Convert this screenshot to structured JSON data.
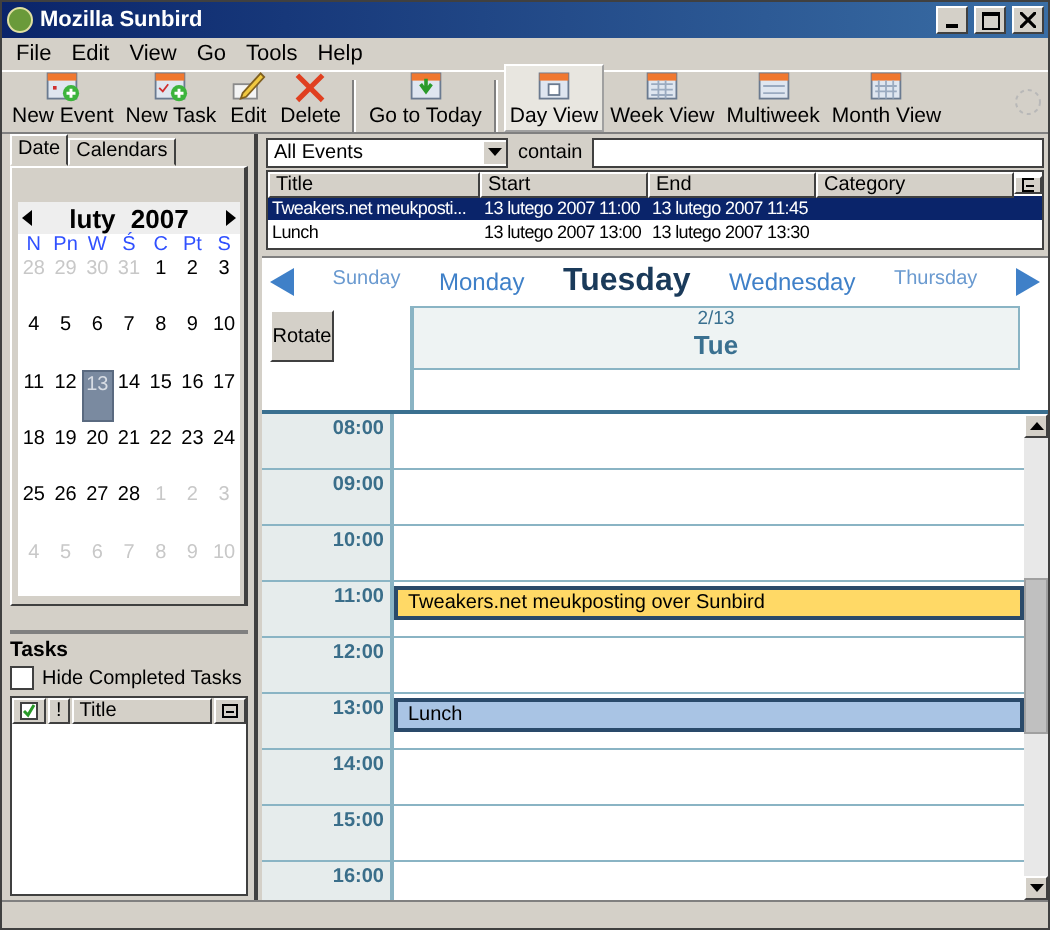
{
  "window": {
    "title": "Mozilla Sunbird"
  },
  "menu": [
    "File",
    "Edit",
    "View",
    "Go",
    "Tools",
    "Help"
  ],
  "toolbar": [
    {
      "label": "New Event",
      "kind": "event",
      "selected": false
    },
    {
      "label": "New Task",
      "kind": "task",
      "selected": false
    },
    {
      "label": "Edit",
      "kind": "edit",
      "selected": false
    },
    {
      "label": "Delete",
      "kind": "delete",
      "selected": false
    },
    {
      "label": "Go to Today",
      "kind": "today",
      "selected": false
    },
    {
      "label": "Day View",
      "kind": "day",
      "selected": true
    },
    {
      "label": "Week View",
      "kind": "week",
      "selected": false
    },
    {
      "label": "Multiweek",
      "kind": "multiweek",
      "selected": false
    },
    {
      "label": "Month View",
      "kind": "month",
      "selected": false
    }
  ],
  "sidebar": {
    "tabs": [
      {
        "label": "Date",
        "selected": true
      },
      {
        "label": "Calendars",
        "selected": false
      }
    ],
    "mini_calendar": {
      "month": "luty",
      "year": "2007",
      "weekdays": [
        "N",
        "Pn",
        "W",
        "Ś",
        "C",
        "Pt",
        "S"
      ],
      "days": [
        {
          "label": "28",
          "other_month": true,
          "selected": false
        },
        {
          "label": "29",
          "other_month": true,
          "selected": false
        },
        {
          "label": "30",
          "other_month": true,
          "selected": false
        },
        {
          "label": "31",
          "other_month": true,
          "selected": false
        },
        {
          "label": "1",
          "other_month": false,
          "selected": false
        },
        {
          "label": "2",
          "other_month": false,
          "selected": false
        },
        {
          "label": "3",
          "other_month": false,
          "selected": false
        },
        {
          "label": "4",
          "other_month": false,
          "selected": false
        },
        {
          "label": "5",
          "other_month": false,
          "selected": false
        },
        {
          "label": "6",
          "other_month": false,
          "selected": false
        },
        {
          "label": "7",
          "other_month": false,
          "selected": false
        },
        {
          "label": "8",
          "other_month": false,
          "selected": false
        },
        {
          "label": "9",
          "other_month": false,
          "selected": false
        },
        {
          "label": "10",
          "other_month": false,
          "selected": false
        },
        {
          "label": "11",
          "other_month": false,
          "selected": false
        },
        {
          "label": "12",
          "other_month": false,
          "selected": false
        },
        {
          "label": "13",
          "other_month": false,
          "selected": true
        },
        {
          "label": "14",
          "other_month": false,
          "selected": false
        },
        {
          "label": "15",
          "other_month": false,
          "selected": false
        },
        {
          "label": "16",
          "other_month": false,
          "selected": false
        },
        {
          "label": "17",
          "other_month": false,
          "selected": false
        },
        {
          "label": "18",
          "other_month": false,
          "selected": false
        },
        {
          "label": "19",
          "other_month": false,
          "selected": false
        },
        {
          "label": "20",
          "other_month": false,
          "selected": false
        },
        {
          "label": "21",
          "other_month": false,
          "selected": false
        },
        {
          "label": "22",
          "other_month": false,
          "selected": false
        },
        {
          "label": "23",
          "other_month": false,
          "selected": false
        },
        {
          "label": "24",
          "other_month": false,
          "selected": false
        },
        {
          "label": "25",
          "other_month": false,
          "selected": false
        },
        {
          "label": "26",
          "other_month": false,
          "selected": false
        },
        {
          "label": "27",
          "other_month": false,
          "selected": false
        },
        {
          "label": "28",
          "other_month": false,
          "selected": false
        },
        {
          "label": "1",
          "other_month": true,
          "selected": false
        },
        {
          "label": "2",
          "other_month": true,
          "selected": false
        },
        {
          "label": "3",
          "other_month": true,
          "selected": false
        },
        {
          "label": "4",
          "other_month": true,
          "selected": false
        },
        {
          "label": "5",
          "other_month": true,
          "selected": false
        },
        {
          "label": "6",
          "other_month": true,
          "selected": false
        },
        {
          "label": "7",
          "other_month": true,
          "selected": false
        },
        {
          "label": "8",
          "other_month": true,
          "selected": false
        },
        {
          "label": "9",
          "other_month": true,
          "selected": false
        },
        {
          "label": "10",
          "other_month": true,
          "selected": false
        }
      ]
    }
  },
  "tasks": {
    "title": "Tasks",
    "hide_completed": {
      "label": "Hide Completed Tasks",
      "checked": false
    },
    "columns": [
      {
        "kind": "check"
      },
      {
        "kind": "text",
        "label": "!"
      },
      {
        "kind": "text",
        "label": "Title"
      }
    ]
  },
  "filter": {
    "value": "All Events",
    "contain_label": "contain"
  },
  "event_list": {
    "columns": [
      "Title",
      "Start",
      "End",
      "Category"
    ],
    "rows": [
      {
        "cells": [
          "Tweakers.net meukposti...",
          "13 lutego 2007 11:00",
          "13 lutego 2007 11:45",
          ""
        ],
        "selected": true
      },
      {
        "cells": [
          "Lunch",
          "13 lutego 2007 13:00",
          "13 lutego 2007 13:30",
          ""
        ],
        "selected": false
      }
    ]
  },
  "day_nav": {
    "days": [
      {
        "label": "Sunday",
        "kind": "far"
      },
      {
        "label": "Monday",
        "kind": "near"
      },
      {
        "label": "Tuesday",
        "kind": "current"
      },
      {
        "label": "Wednesday",
        "kind": "near"
      },
      {
        "label": "Thursday",
        "kind": "far"
      }
    ]
  },
  "rotate_button": "Rotate",
  "day_header": {
    "date": "2/13",
    "weekday": "Tue"
  },
  "hours": [
    {
      "label": "08:00"
    },
    {
      "label": "09:00"
    },
    {
      "label": "10:00"
    },
    {
      "label": "11:00",
      "events": [
        {
          "title": "Tweakers.net meukposting over Sunbird",
          "color": "#ffd966"
        }
      ]
    },
    {
      "label": "12:00"
    },
    {
      "label": "13:00",
      "events": [
        {
          "title": "Lunch",
          "color": "#a9c4e4"
        }
      ]
    },
    {
      "label": "14:00"
    },
    {
      "label": "15:00"
    },
    {
      "label": "16:00"
    }
  ]
}
